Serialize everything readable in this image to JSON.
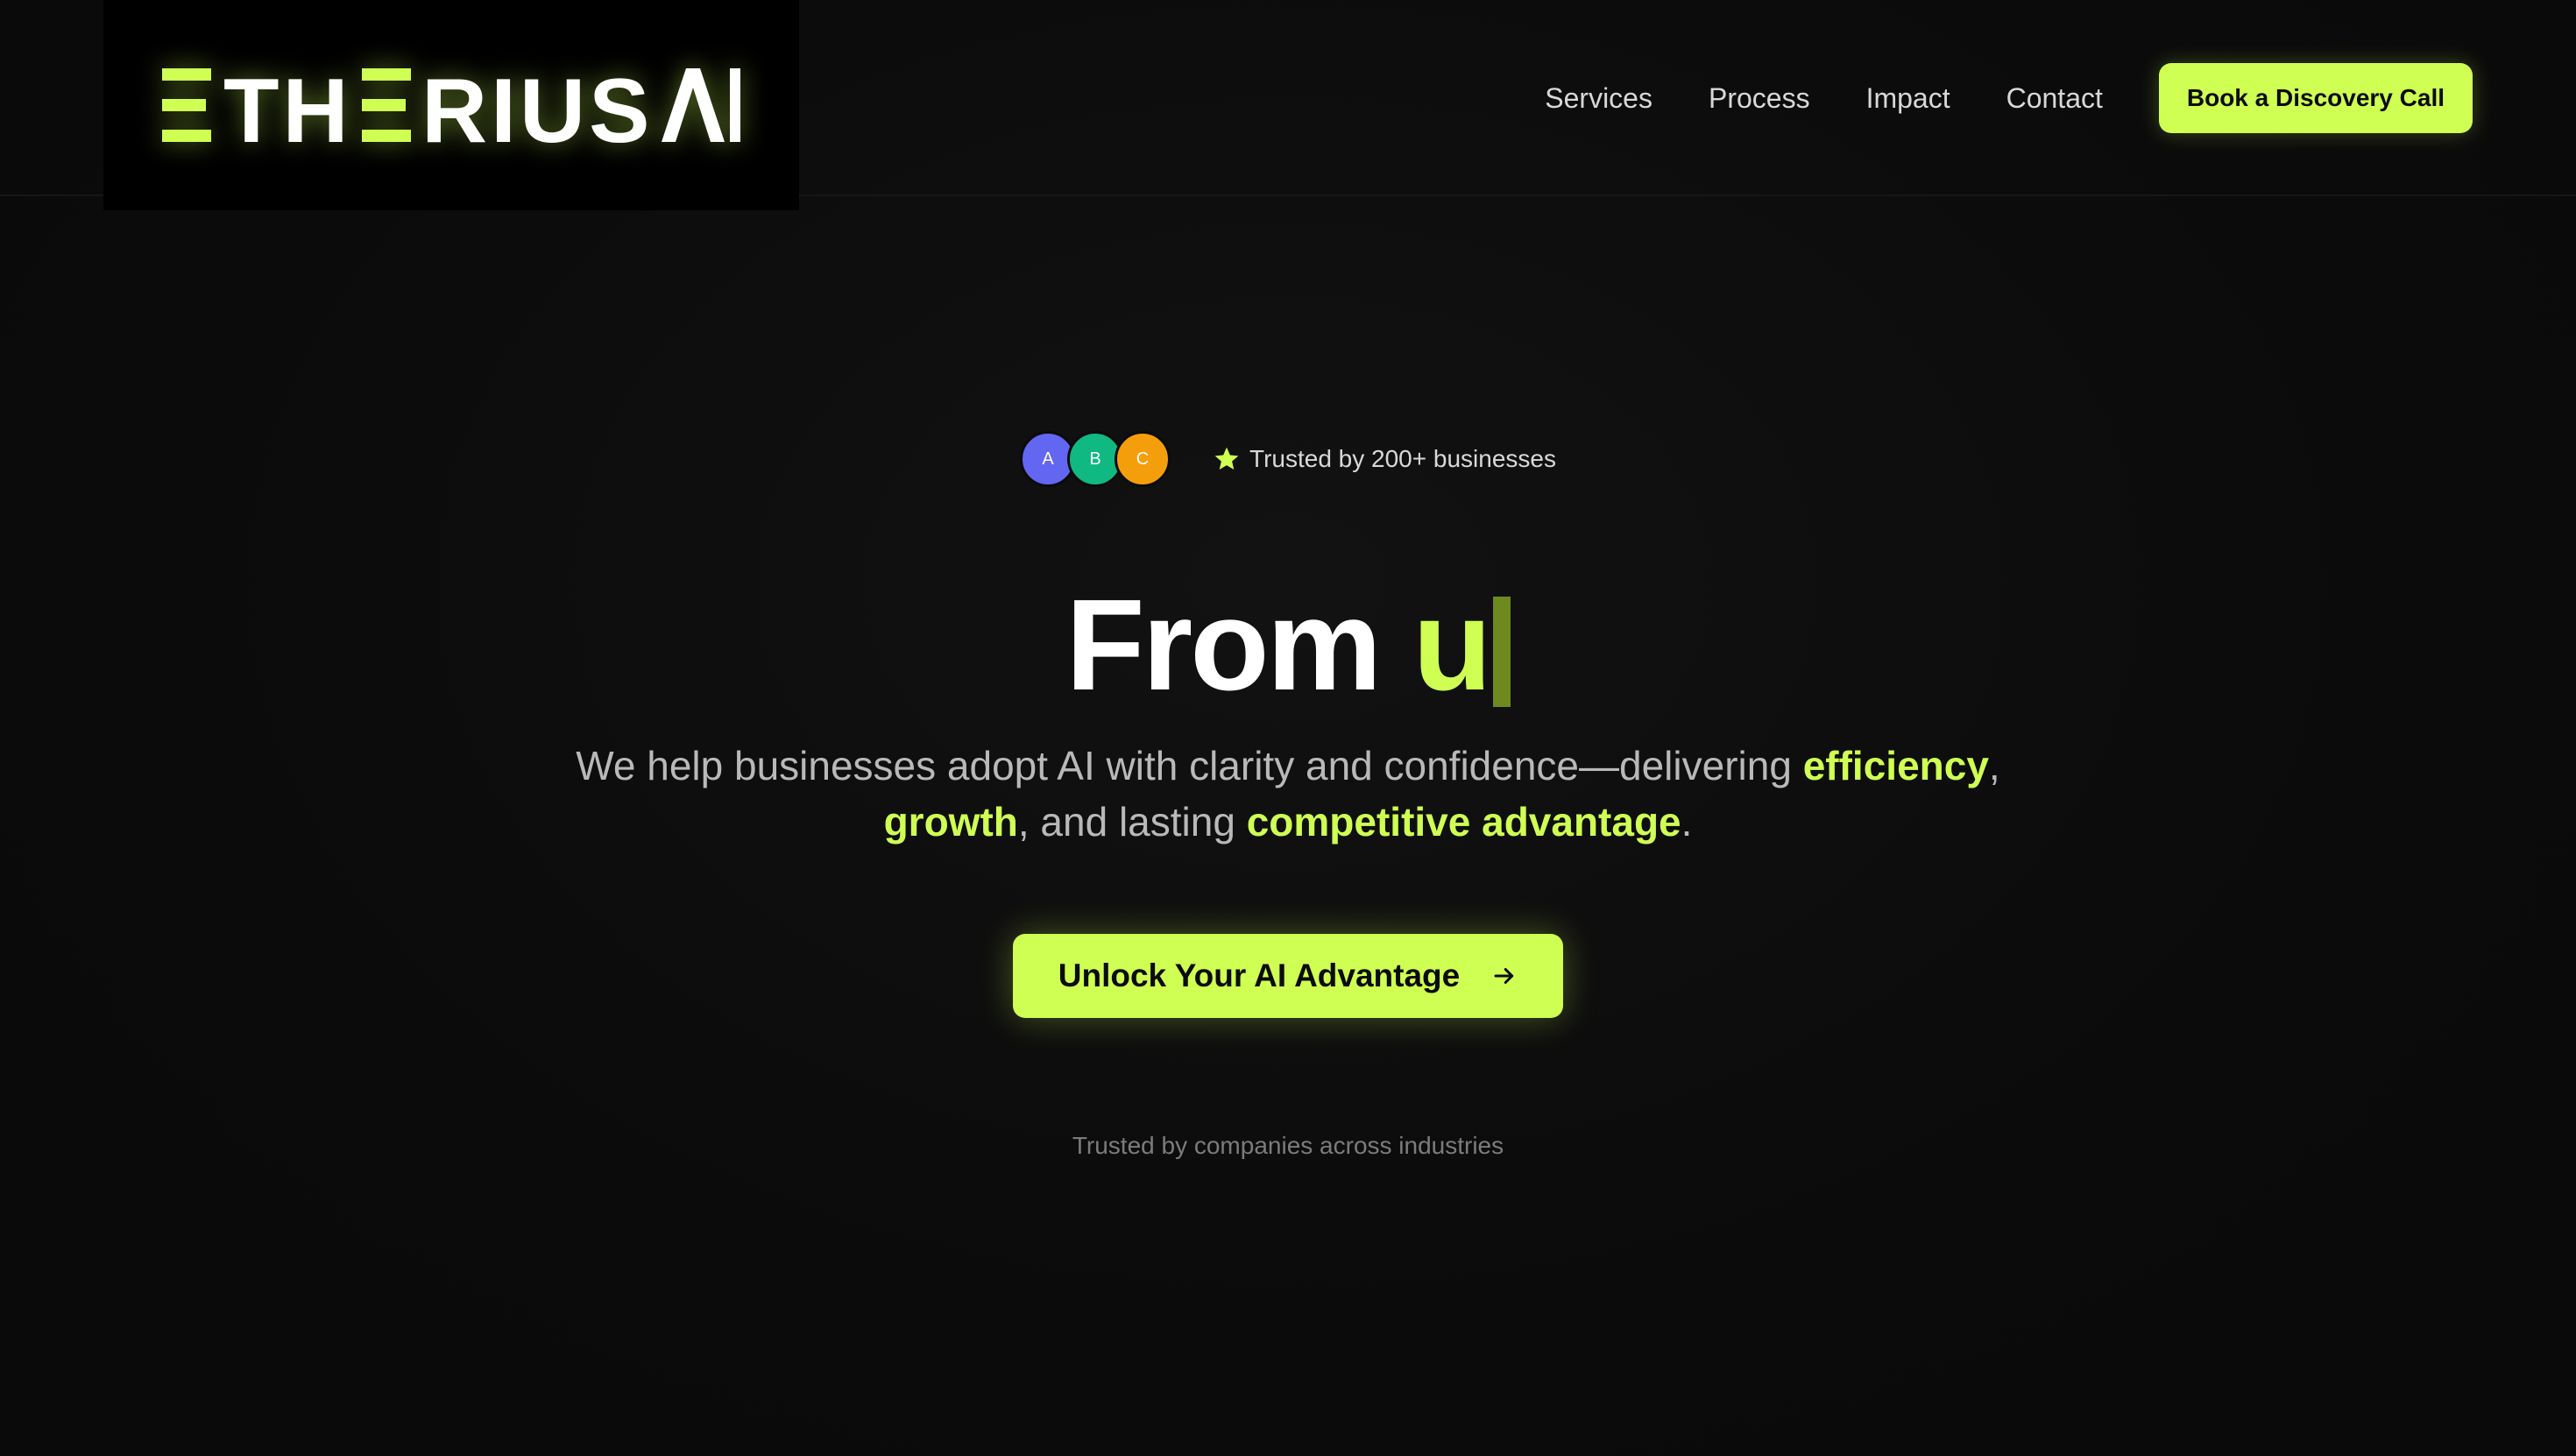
{
  "brand": {
    "logo_text": "ETHERIUS AI",
    "accent_color": "#cfff53"
  },
  "nav": {
    "links": [
      "Services",
      "Process",
      "Impact",
      "Contact"
    ],
    "cta_label": "Book a Discovery Call"
  },
  "hero": {
    "avatars": [
      {
        "initial": "A",
        "color": "#6366f1"
      },
      {
        "initial": "B",
        "color": "#10b981"
      },
      {
        "initial": "C",
        "color": "#f59e0b"
      }
    ],
    "trust_icon": "star-icon",
    "trust_text": "Trusted by 200+ businesses",
    "headline_static": "From ",
    "headline_typed": "u",
    "subhead": {
      "part1": "We help businesses adopt AI with clarity and confidence—delivering ",
      "hl1": "efficiency",
      "part2": ", ",
      "hl2": "growth",
      "part3": ", and lasting ",
      "hl3": "competitive advantage",
      "part4": "."
    },
    "cta_label": "Unlock Your AI Advantage",
    "cta_icon": "arrow-right-icon"
  },
  "footer_note": "Trusted by companies across industries"
}
